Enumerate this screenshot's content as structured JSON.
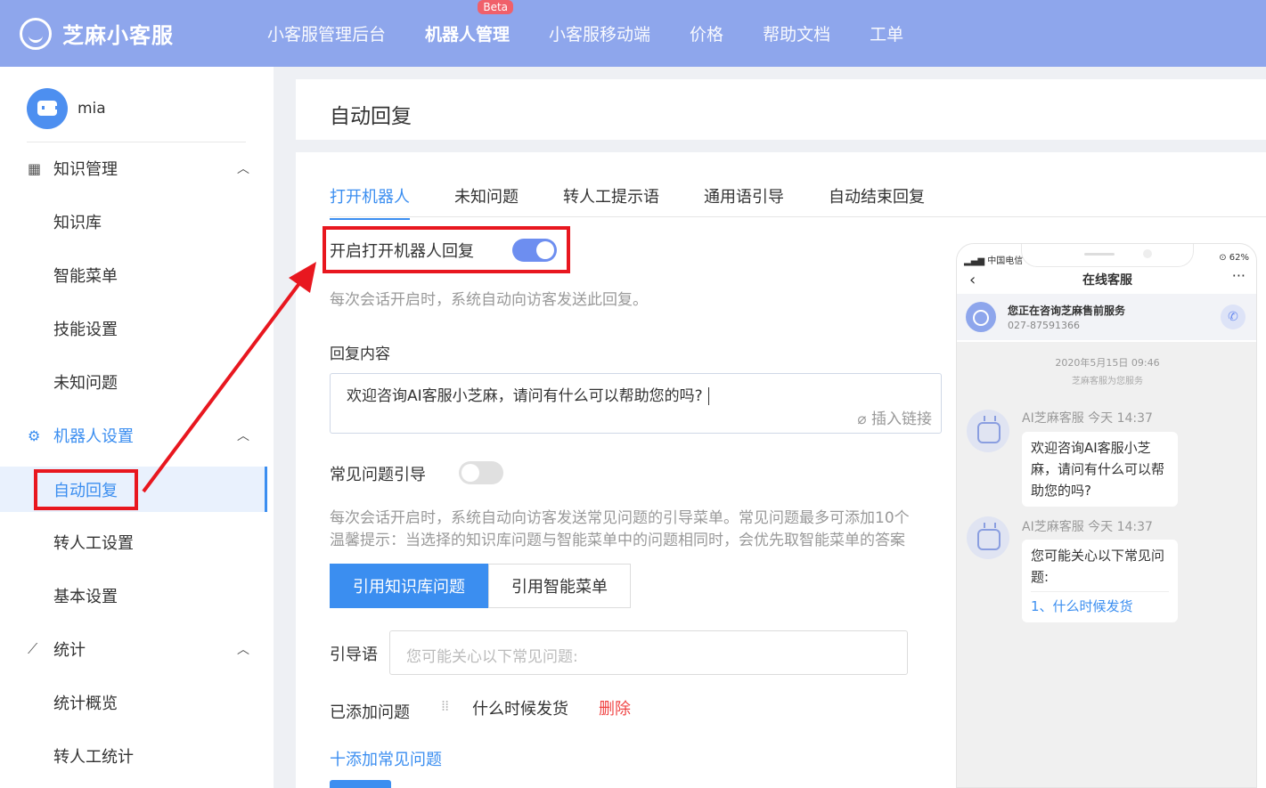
{
  "brand": {
    "name": "芝麻小客服"
  },
  "topnav": {
    "items": [
      "小客服管理后台",
      "机器人管理",
      "小客服移动端",
      "价格",
      "帮助文档",
      "工单"
    ],
    "beta": "Beta"
  },
  "user": {
    "name": "mia"
  },
  "sidebar": {
    "group1": {
      "label": "知识管理",
      "chevron": "^"
    },
    "group1_items": [
      "知识库",
      "智能菜单",
      "技能设置",
      "未知问题"
    ],
    "group2": {
      "label": "机器人设置",
      "chevron": "^"
    },
    "group2_items": [
      "自动回复",
      "转人工设置",
      "基本设置"
    ],
    "group3": {
      "label": "统计",
      "chevron": "^"
    },
    "group3_items": [
      "统计概览",
      "转人工统计"
    ]
  },
  "page": {
    "title": "自动回复"
  },
  "tabs": [
    "打开机器人",
    "未知问题",
    "转人工提示语",
    "通用语引导",
    "自动结束回复"
  ],
  "form": {
    "toggle1_label": "开启打开机器人回复",
    "toggle1_on": true,
    "toggle1_hint": "每次会话开启时，系统自动向访客发送此回复。",
    "reply_label": "回复内容",
    "reply_value": "欢迎咨询AI客服小芝麻，请问有什么可以帮助您的吗?",
    "insert_link": "插入链接",
    "toggle2_label": "常见问题引导",
    "toggle2_on": false,
    "toggle2_hint1": "每次会话开启时，系统自动向访客发送常见问题的引导菜单。常见问题最多可添加10个",
    "toggle2_hint2": "温馨提示：当选择的知识库问题与智能菜单中的问题相同时，会优先取智能菜单的答案",
    "btn_kb": "引用知识库问题",
    "btn_menu": "引用智能菜单",
    "guide_label": "引导语",
    "guide_placeholder": "您可能关心以下常见问题:",
    "added_label": "已添加问题",
    "added_question": "什么时候发货",
    "delete": "删除",
    "add_question": "十添加常见问题"
  },
  "phone": {
    "carrier": "中国电信",
    "battery": "62%",
    "title": "在线客服",
    "info_name": "您正在咨询芝麻售前服务",
    "info_phone": "027-87591366",
    "date": "2020年5月15日 09:46",
    "subline": "芝麻客服为您服务",
    "msg1_name": "AI芝麻客服 今天 14:37",
    "msg1_text": "欢迎咨询AI客服小芝麻，请问有什么可以帮助您的吗?",
    "msg2_name": "AI芝麻客服 今天 14:37",
    "msg2_text": "您可能关心以下常见问题:",
    "msg2_link": "1、什么时候发货"
  },
  "colors": {
    "topbar": "#8ea6ec",
    "accent": "#3b8ef0",
    "highlight": "#e8171f"
  }
}
